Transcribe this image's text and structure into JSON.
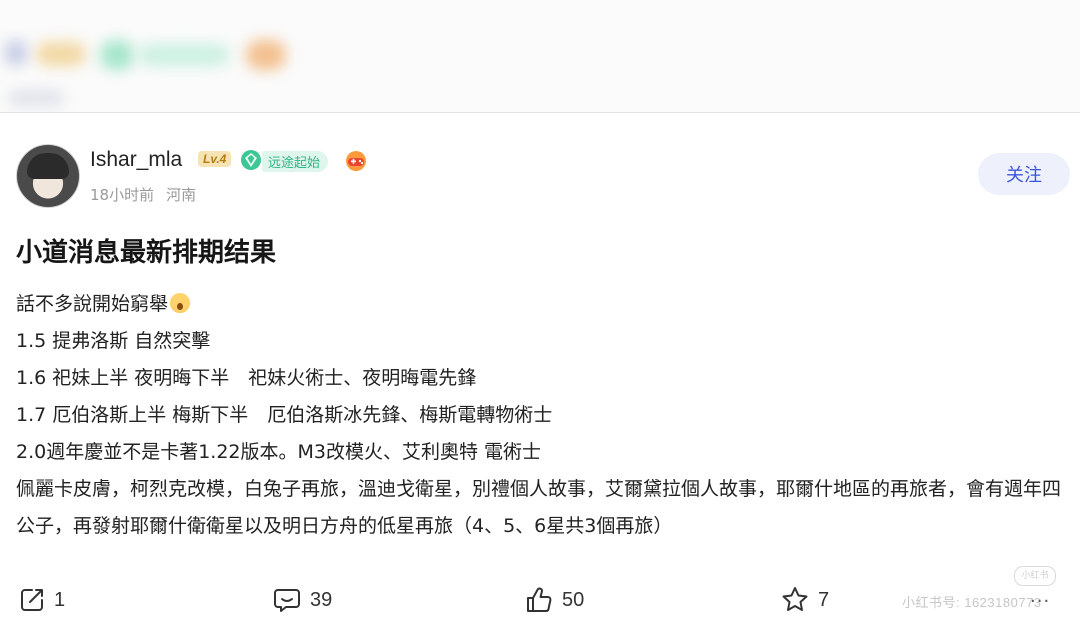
{
  "user": {
    "name": "Ishar_mla",
    "level": "Lv.4",
    "title_badge": "远途起始",
    "time": "18小时前",
    "location": "河南",
    "follow_label": "关注"
  },
  "post": {
    "title": "小道消息最新排期结果",
    "lines": [
      "話不多說開始窮舉",
      "1.5 提弗洛斯 自然突擊",
      "1.6 祀妹上半 夜明晦下半　祀妹火術士、夜明晦電先鋒",
      "1.7 厄伯洛斯上半 梅斯下半　厄伯洛斯冰先鋒、梅斯電轉物術士",
      "2.0週年慶並不是卡著1.22版本。M3改模火、艾利奧特 電術士",
      "佩麗卡皮膚，柯烈克改模，白兔子再旅，溫迪戈衛星，別禮個人故事，艾爾黛拉個人故事，耶爾什地區的再旅者，會有週年四公子，再發射耶爾什衛衛星以及明日方舟的低星再旅（4、5、6星共3個再旅）"
    ]
  },
  "actions": {
    "share_count": "1",
    "comment_count": "39",
    "like_count": "50",
    "collect_count": "7"
  },
  "watermark": {
    "text": "小红书号: 1623180773",
    "logo": "小红书",
    "more": "..."
  }
}
